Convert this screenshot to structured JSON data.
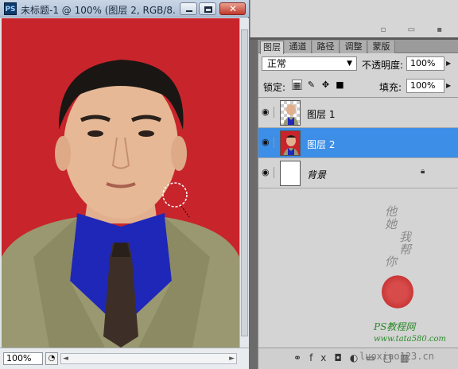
{
  "document": {
    "app_icon": "PS",
    "title": "未标题-1 @ 100% (图层 2, RGB/8...",
    "zoom": "100%",
    "close_glyph": "✕"
  },
  "layers_panel": {
    "tabs": [
      "图层",
      "通道",
      "路径",
      "调整",
      "蒙版"
    ],
    "blend_mode": "正常",
    "opacity_label": "不透明度:",
    "opacity_value": "100%",
    "lock_label": "锁定:",
    "fill_label": "填充:",
    "fill_value": "100%",
    "layers": [
      {
        "name": "图层 1",
        "visible": true,
        "selected": false,
        "thumb": "checker-person"
      },
      {
        "name": "图层 2",
        "visible": true,
        "selected": true,
        "thumb": "photo"
      },
      {
        "name": "背景",
        "visible": true,
        "selected": false,
        "thumb": "white",
        "locked": true
      }
    ],
    "footer_icons": [
      "link-icon",
      "fx-icon",
      "mask-icon",
      "adjustment-icon",
      "folder-icon",
      "new-layer-icon",
      "trash-icon"
    ]
  },
  "watermark": {
    "vertical_text": [
      "他",
      "她",
      "我",
      "帮",
      "你"
    ],
    "brand_text": "PS教程网",
    "url_1": "www.tata580.com",
    "url_2": "luoxiao123.cn"
  },
  "colors": {
    "selection": "#3d8ee6",
    "canvas_background": "#c8242c",
    "suit": "#9a9870",
    "shirt": "#1f27b8"
  }
}
